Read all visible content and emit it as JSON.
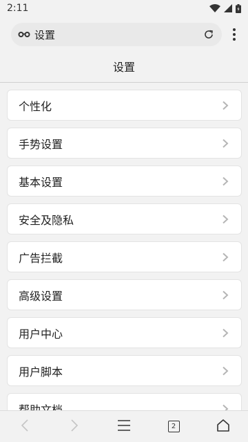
{
  "status_bar": {
    "time": "2:11"
  },
  "address_bar": {
    "text": "设置",
    "icon": "incognito-glasses-icon",
    "reload_icon": "reload-icon"
  },
  "page": {
    "title": "设置"
  },
  "settings_items": [
    {
      "label": "个性化"
    },
    {
      "label": "手势设置"
    },
    {
      "label": "基本设置"
    },
    {
      "label": "安全及隐私"
    },
    {
      "label": "广告拦截"
    },
    {
      "label": "高级设置"
    },
    {
      "label": "用户中心"
    },
    {
      "label": "用户脚本"
    },
    {
      "label": "帮助文档"
    }
  ],
  "bottom_bar": {
    "tab_count": "2"
  },
  "colors": {
    "background": "#f2f2f2",
    "card": "#ffffff",
    "address_bar": "#e9e9e9",
    "chevron": "#b5b5b5",
    "disabled_nav": "#c5c5c5"
  }
}
